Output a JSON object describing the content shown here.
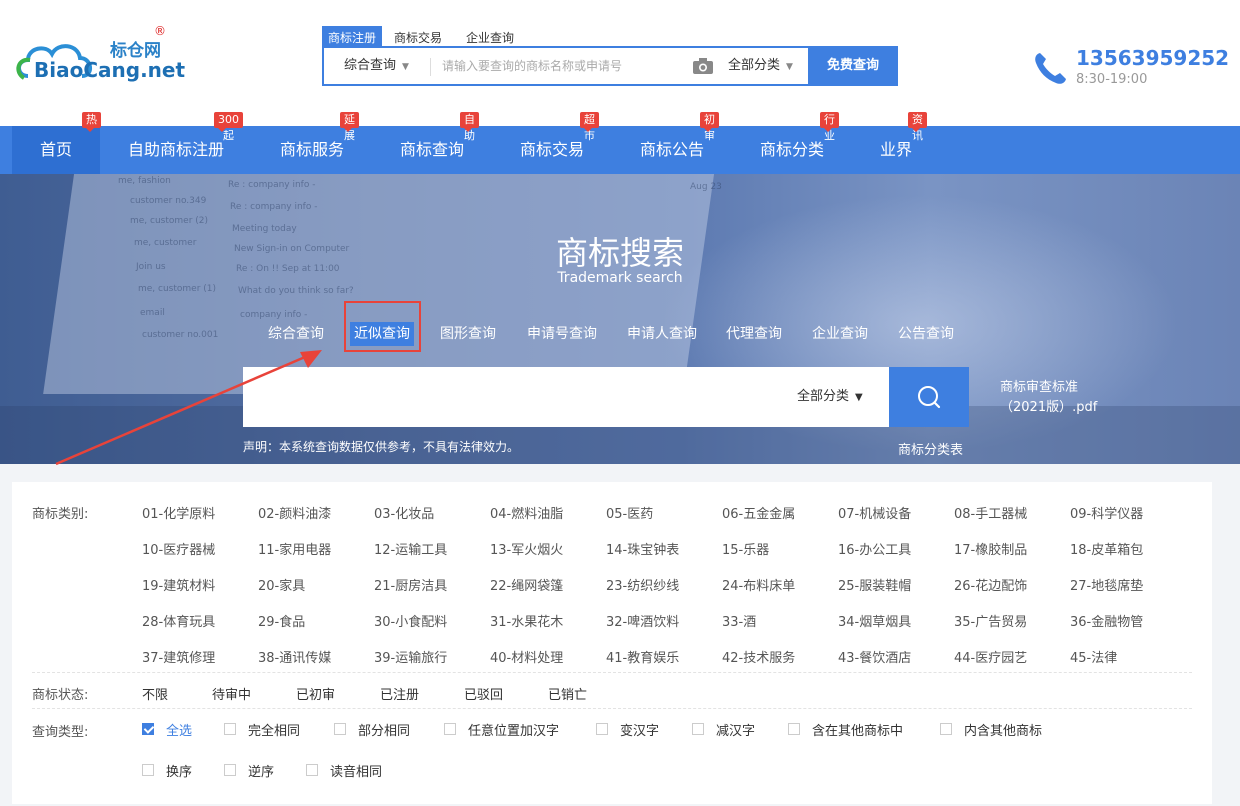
{
  "logo": {
    "cn": "标仓网",
    "reg": "®",
    "en": "BiaoCang.net"
  },
  "top_search": {
    "tabs": [
      "商标注册",
      "商标交易",
      "企业查询"
    ],
    "mode": "综合查询",
    "placeholder": "请输入要查询的商标名称或申请号",
    "category": "全部分类",
    "button": "免费查询"
  },
  "contact": {
    "phone": "13563959252",
    "hours": "8:30-19:00"
  },
  "nav": [
    {
      "label": "首页",
      "badge": "热"
    },
    {
      "label": "自助商标注册",
      "badge": "300起"
    },
    {
      "label": "商标服务",
      "badge": "延展"
    },
    {
      "label": "商标查询",
      "badge": "自助"
    },
    {
      "label": "商标交易",
      "badge": "超市"
    },
    {
      "label": "商标公告",
      "badge": "初审"
    },
    {
      "label": "商标分类",
      "badge": "行业"
    },
    {
      "label": "业界",
      "badge": "资讯"
    }
  ],
  "hero": {
    "title": "商标搜索",
    "subtitle": "Trademark search",
    "query_tabs": [
      "综合查询",
      "近似查询",
      "图形查询",
      "申请号查询",
      "申请人查询",
      "代理查询",
      "企业查询",
      "公告查询"
    ],
    "active_tab": "近似查询",
    "category": "全部分类",
    "pdf_line1": "商标审查标准",
    "pdf_line2": "（2021版）.pdf",
    "disclaimer": "声明：本系统查询数据仅供参考，不具有法律效力。",
    "class_table": "商标分类表",
    "screen_rows": [
      "me, fashion",
      "customer no.349",
      "me, customer (2)",
      "me, customer",
      "Join us",
      "me, customer (1)",
      "email",
      "customer no.001",
      "Re : company info -",
      "Re : company info -",
      "Meeting today",
      "New Sign-in on Computer",
      "Re : On !! Sep at 11:00",
      "What do you think so far?",
      "company info -",
      "Aug 23"
    ]
  },
  "filters": {
    "category_label": "商标类别:",
    "categories": [
      "01-化学原料",
      "02-颜料油漆",
      "03-化妆品",
      "04-燃料油脂",
      "05-医药",
      "06-五金金属",
      "07-机械设备",
      "08-手工器械",
      "09-科学仪器",
      "10-医疗器械",
      "11-家用电器",
      "12-运输工具",
      "13-军火烟火",
      "14-珠宝钟表",
      "15-乐器",
      "16-办公工具",
      "17-橡胶制品",
      "18-皮革箱包",
      "19-建筑材料",
      "20-家具",
      "21-厨房洁具",
      "22-绳网袋篷",
      "23-纺织纱线",
      "24-布料床单",
      "25-服装鞋帽",
      "26-花边配饰",
      "27-地毯席垫",
      "28-体育玩具",
      "29-食品",
      "30-小食配料",
      "31-水果花木",
      "32-啤酒饮料",
      "33-酒",
      "34-烟草烟具",
      "35-广告贸易",
      "36-金融物管",
      "37-建筑修理",
      "38-通讯传媒",
      "39-运输旅行",
      "40-材料处理",
      "41-教育娱乐",
      "42-技术服务",
      "43-餐饮酒店",
      "44-医疗园艺",
      "45-法律"
    ],
    "status_label": "商标状态:",
    "statuses": [
      "不限",
      "待审中",
      "已初审",
      "已注册",
      "已驳回",
      "已销亡"
    ],
    "type_label": "查询类型:",
    "types": [
      {
        "label": "全选",
        "checked": true
      },
      {
        "label": "完全相同",
        "checked": false
      },
      {
        "label": "部分相同",
        "checked": false
      },
      {
        "label": "任意位置加汉字",
        "checked": false
      },
      {
        "label": "变汉字",
        "checked": false
      },
      {
        "label": "减汉字",
        "checked": false
      },
      {
        "label": "含在其他商标中",
        "checked": false
      },
      {
        "label": "内含其他商标",
        "checked": false
      },
      {
        "label": "换序",
        "checked": false
      },
      {
        "label": "逆序",
        "checked": false
      },
      {
        "label": "读音相同",
        "checked": false
      }
    ]
  },
  "colors": {
    "primary": "#3e7fe0",
    "badge": "#e8433a",
    "highlight_box": "#e8433a"
  }
}
